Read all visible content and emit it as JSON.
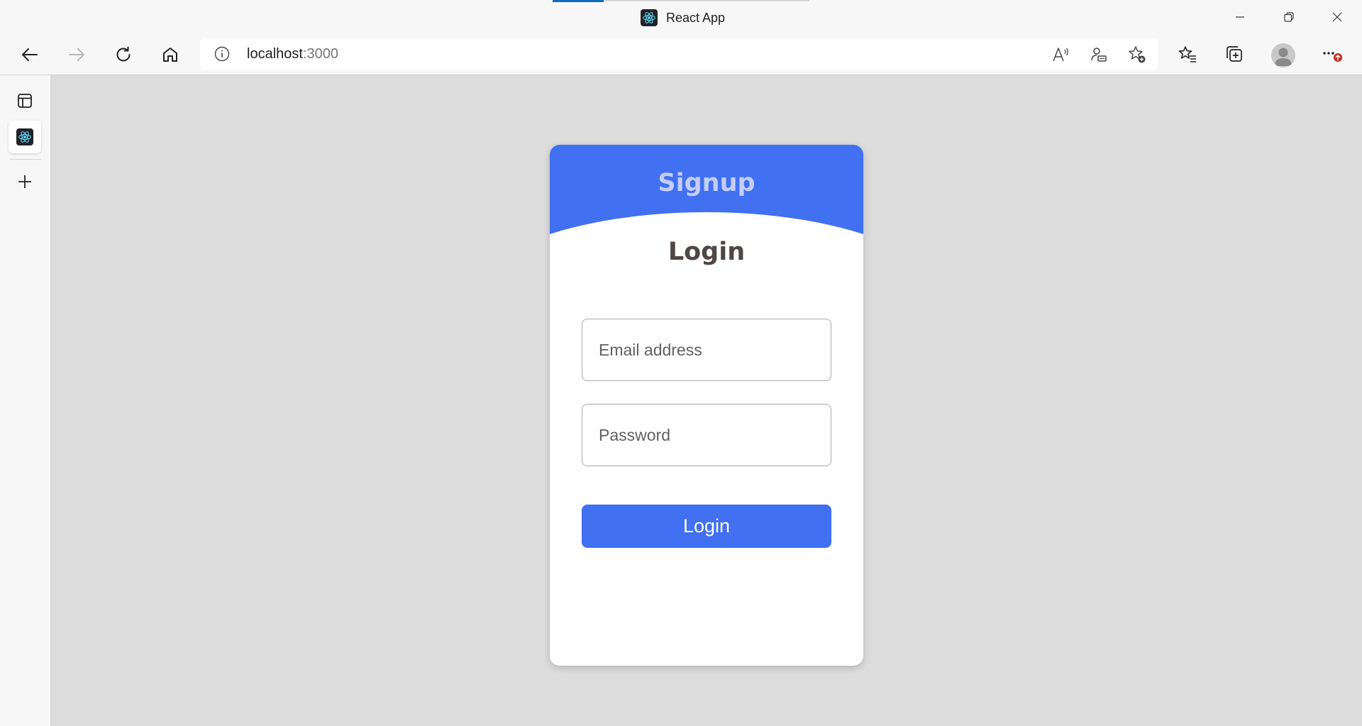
{
  "browser": {
    "tab_title": "React App",
    "url_host": "localhost",
    "url_port": ":3000",
    "icons": {
      "back": "back-arrow-icon",
      "forward": "forward-arrow-icon",
      "refresh": "refresh-icon",
      "home": "home-icon",
      "site_info": "info-icon",
      "read_aloud": "read-aloud-icon",
      "profile_sync": "profile-sync-icon",
      "add_favorite": "star-add-icon",
      "favorites": "favorites-icon",
      "collections": "collections-icon",
      "menu": "more-icon"
    },
    "accent_color": "#0f6cbd",
    "notification_color": "#c42b1c"
  },
  "card": {
    "signup_label": "Signup",
    "login_heading": "Login",
    "email_placeholder": "Email address",
    "email_value": "",
    "password_placeholder": "Password",
    "password_value": "",
    "login_button": "Login",
    "header_color": "#4170f0"
  }
}
